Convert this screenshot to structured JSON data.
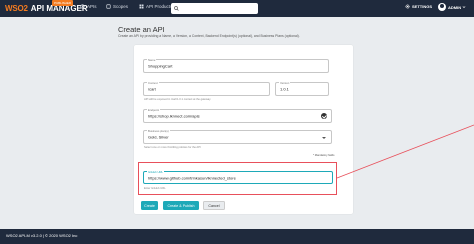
{
  "header": {
    "logo_brand": "WSO2",
    "logo_title": "API MANAGER",
    "logo_badge": "PUBLISHER",
    "nav": [
      {
        "label": "APIs",
        "icon": "apis-icon"
      },
      {
        "label": "Scopes",
        "icon": "scopes-icon"
      },
      {
        "label": "API Products",
        "icon": "api-products-icon"
      }
    ],
    "search_placeholder": "",
    "settings_label": "SETTINGS",
    "user_label": "ADMIN"
  },
  "page": {
    "title": "Create an API",
    "description": "Create an API by providing a Name, a Version, a Context, Backend Endpoint(s) (optional), and Business Plans (optional)."
  },
  "form": {
    "name": {
      "label": "Name",
      "value": "ShoppingCart"
    },
    "context": {
      "label": "Context",
      "value": "/cart",
      "helper": "API will be exposed in /cart/1.0.1 context at the gateway"
    },
    "version": {
      "label": "Version",
      "value": "1.0.1"
    },
    "endpoint": {
      "label": "Endpoint",
      "value": "https://shop.lknnect.com/apis",
      "status_icon": "check-circle-icon"
    },
    "business_plans": {
      "label": "Business plan(s)",
      "value": "Gold, Silver",
      "helper": "Select one or more throttling policies for the API"
    },
    "mandatory_note": "* Mandatory fields",
    "github": {
      "label": "GitHub URL",
      "value": "https://www.github.com/trinkasun/lknnected_store",
      "helper": "Enter GitHub URL"
    }
  },
  "buttons": {
    "create": "Create",
    "create_publish": "Create & Publish",
    "cancel": "Cancel"
  },
  "annotation": {
    "highlight_color": "#e8505b"
  },
  "footer": {
    "text": "WSO2 API-M v3.2.0 | © 2020 WSO2 Inc"
  },
  "colors": {
    "topbar": "#1f2a3d",
    "accent": "#1ea9b8",
    "brand_orange": "#f47b20"
  }
}
